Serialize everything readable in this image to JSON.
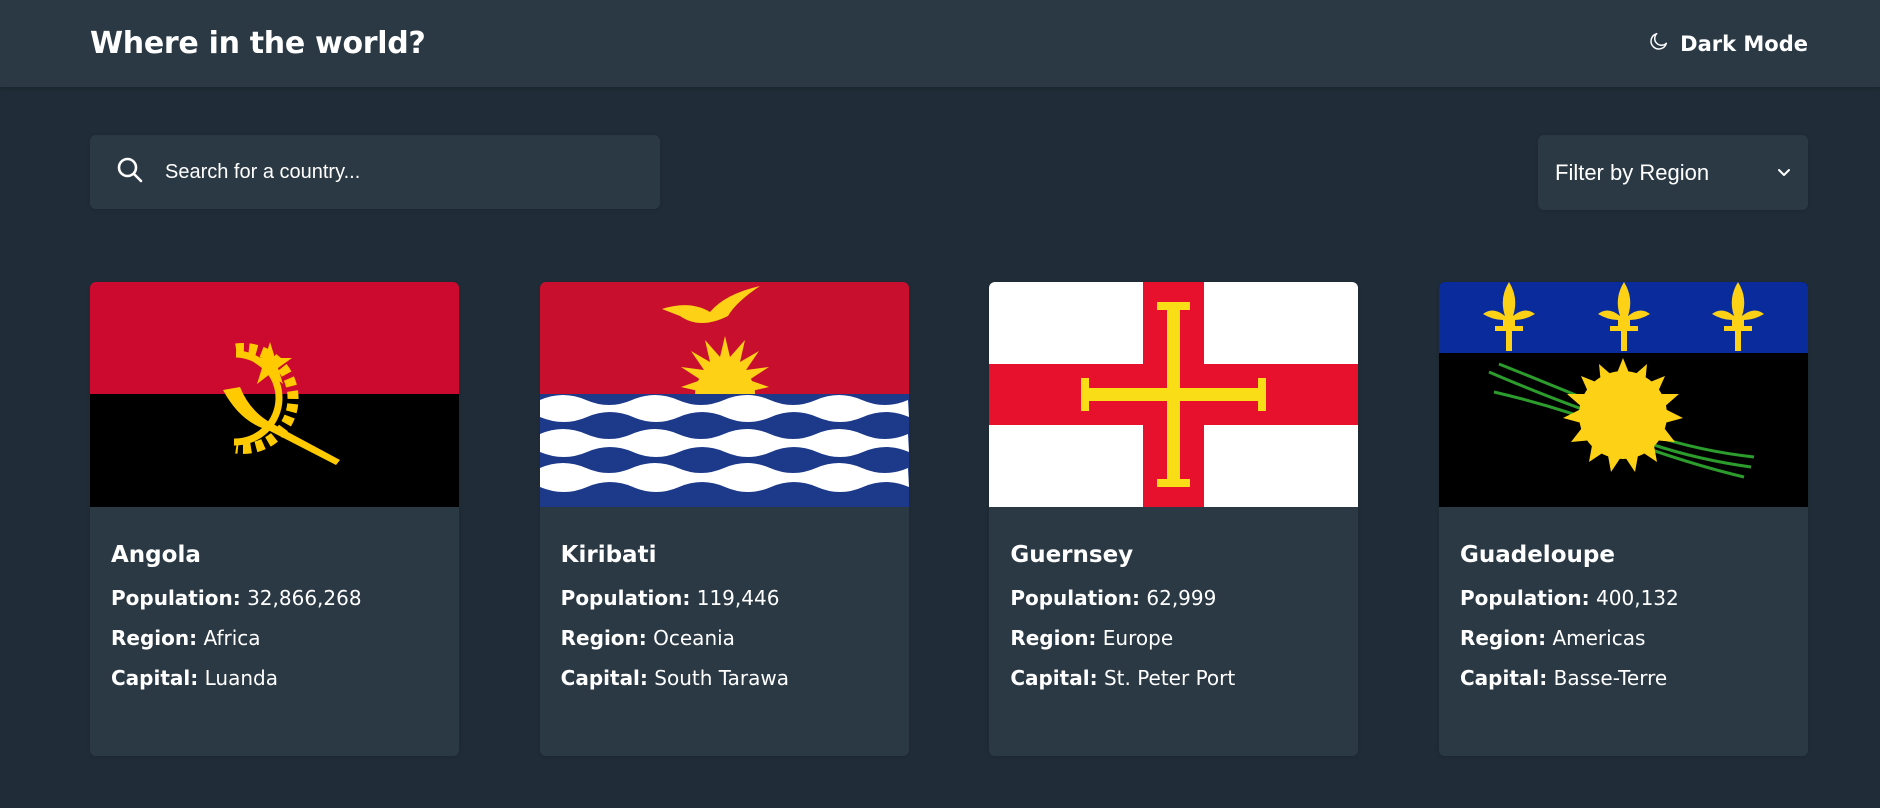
{
  "header": {
    "title": "Where in the world?",
    "theme_toggle_label": "Dark Mode",
    "theme_icon": "moon-icon"
  },
  "search": {
    "placeholder": "Search for a country...",
    "value": "",
    "icon": "search-icon"
  },
  "filter": {
    "label": "Filter by Region",
    "icon": "chevron-down-icon"
  },
  "labels": {
    "population": "Population:",
    "region": "Region:",
    "capital": "Capital:"
  },
  "countries": [
    {
      "name": "Angola",
      "population": "32,866,268",
      "region": "Africa",
      "capital": "Luanda"
    },
    {
      "name": "Kiribati",
      "population": "119,446",
      "region": "Oceania",
      "capital": "South Tarawa"
    },
    {
      "name": "Guernsey",
      "population": "62,999",
      "region": "Europe",
      "capital": "St. Peter Port"
    },
    {
      "name": "Guadeloupe",
      "population": "400,132",
      "region": "Americas",
      "capital": "Basse-Terre"
    }
  ],
  "colors": {
    "background": "#202c37",
    "elements": "#2b3945",
    "text": "#ffffff"
  }
}
